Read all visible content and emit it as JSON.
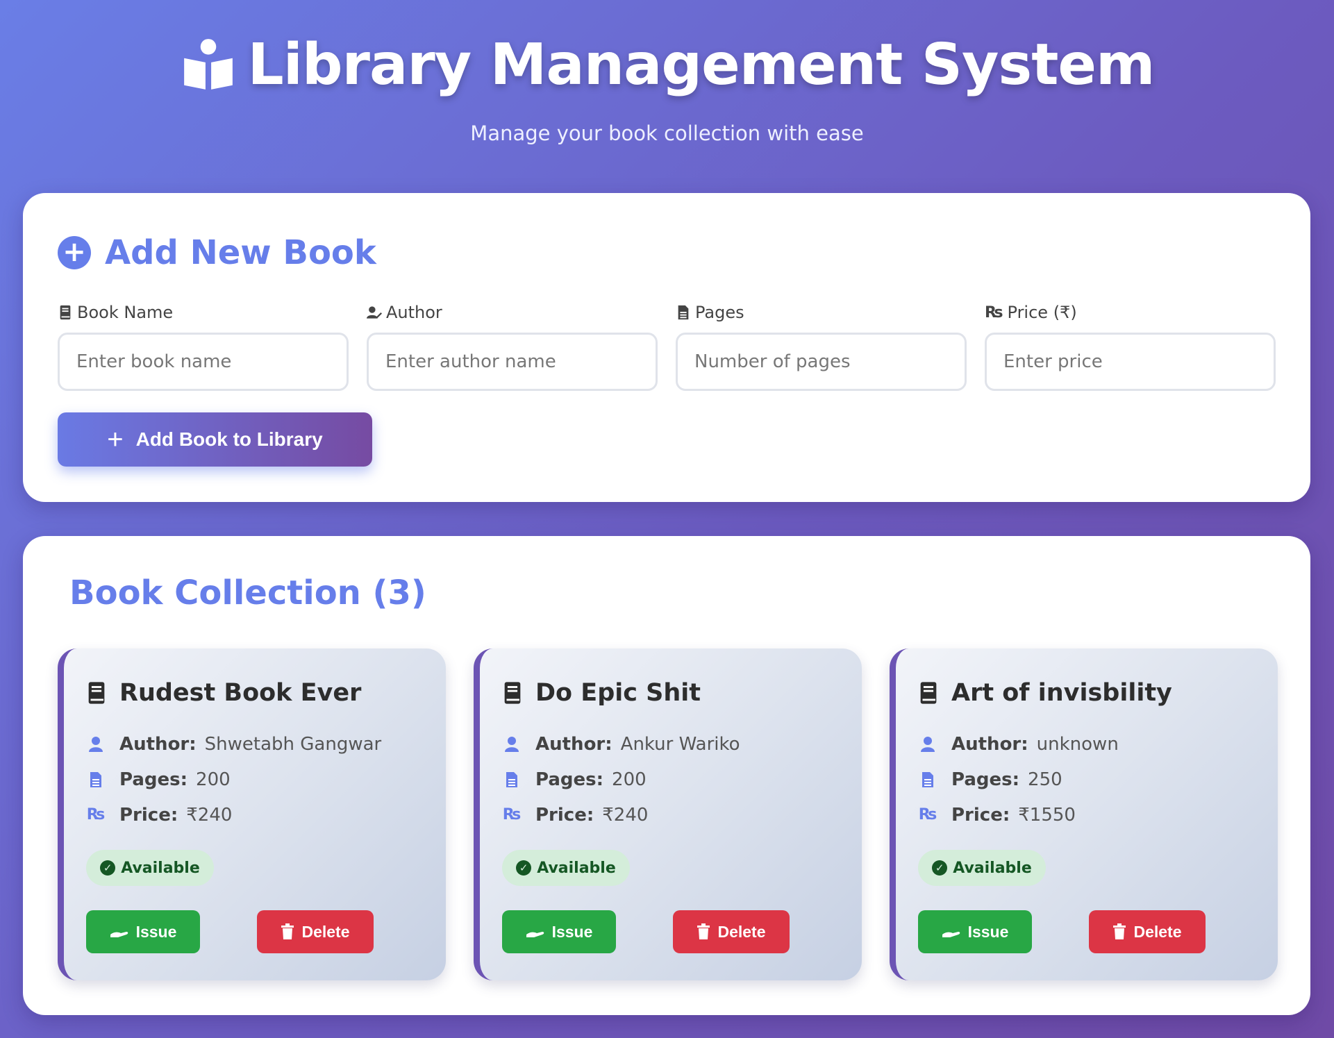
{
  "header": {
    "title": "Library Management System",
    "subtitle": "Manage your book collection with ease",
    "icon": "book-reader-icon"
  },
  "add_form": {
    "title": "Add New Book",
    "fields": [
      {
        "label": "Book Name",
        "placeholder": "Enter book name",
        "value": "",
        "icon": "book-icon"
      },
      {
        "label": "Author",
        "placeholder": "Enter author name",
        "value": "",
        "icon": "user-pen-icon"
      },
      {
        "label": "Pages",
        "placeholder": "Number of pages",
        "value": "",
        "icon": "file-icon"
      },
      {
        "label": "Price (₹)",
        "placeholder": "Enter price",
        "value": "",
        "icon": "rupee-icon"
      }
    ],
    "submit_label": "Add Book to Library"
  },
  "collection": {
    "title": "Book Collection (3)",
    "labels": {
      "author": "Author:",
      "pages": "Pages:",
      "price": "Price:"
    },
    "books": [
      {
        "title": "Rudest Book Ever",
        "author": "Shwetabh Gangwar",
        "pages": "200",
        "price": "₹240",
        "status": "Available",
        "issue_label": "Issue",
        "delete_label": "Delete"
      },
      {
        "title": "Do Epic Shit",
        "author": "Ankur Wariko",
        "pages": "200",
        "price": "₹240",
        "status": "Available",
        "issue_label": "Issue",
        "delete_label": "Delete"
      },
      {
        "title": "Art of invisbility",
        "author": "unknown",
        "pages": "250",
        "price": "₹1550",
        "status": "Available",
        "issue_label": "Issue",
        "delete_label": "Delete"
      }
    ]
  },
  "colors": {
    "accent": "#667eea",
    "issue": "#28a745",
    "delete": "#dc3545",
    "available_bg": "#d4edda",
    "available_text": "#155724"
  }
}
